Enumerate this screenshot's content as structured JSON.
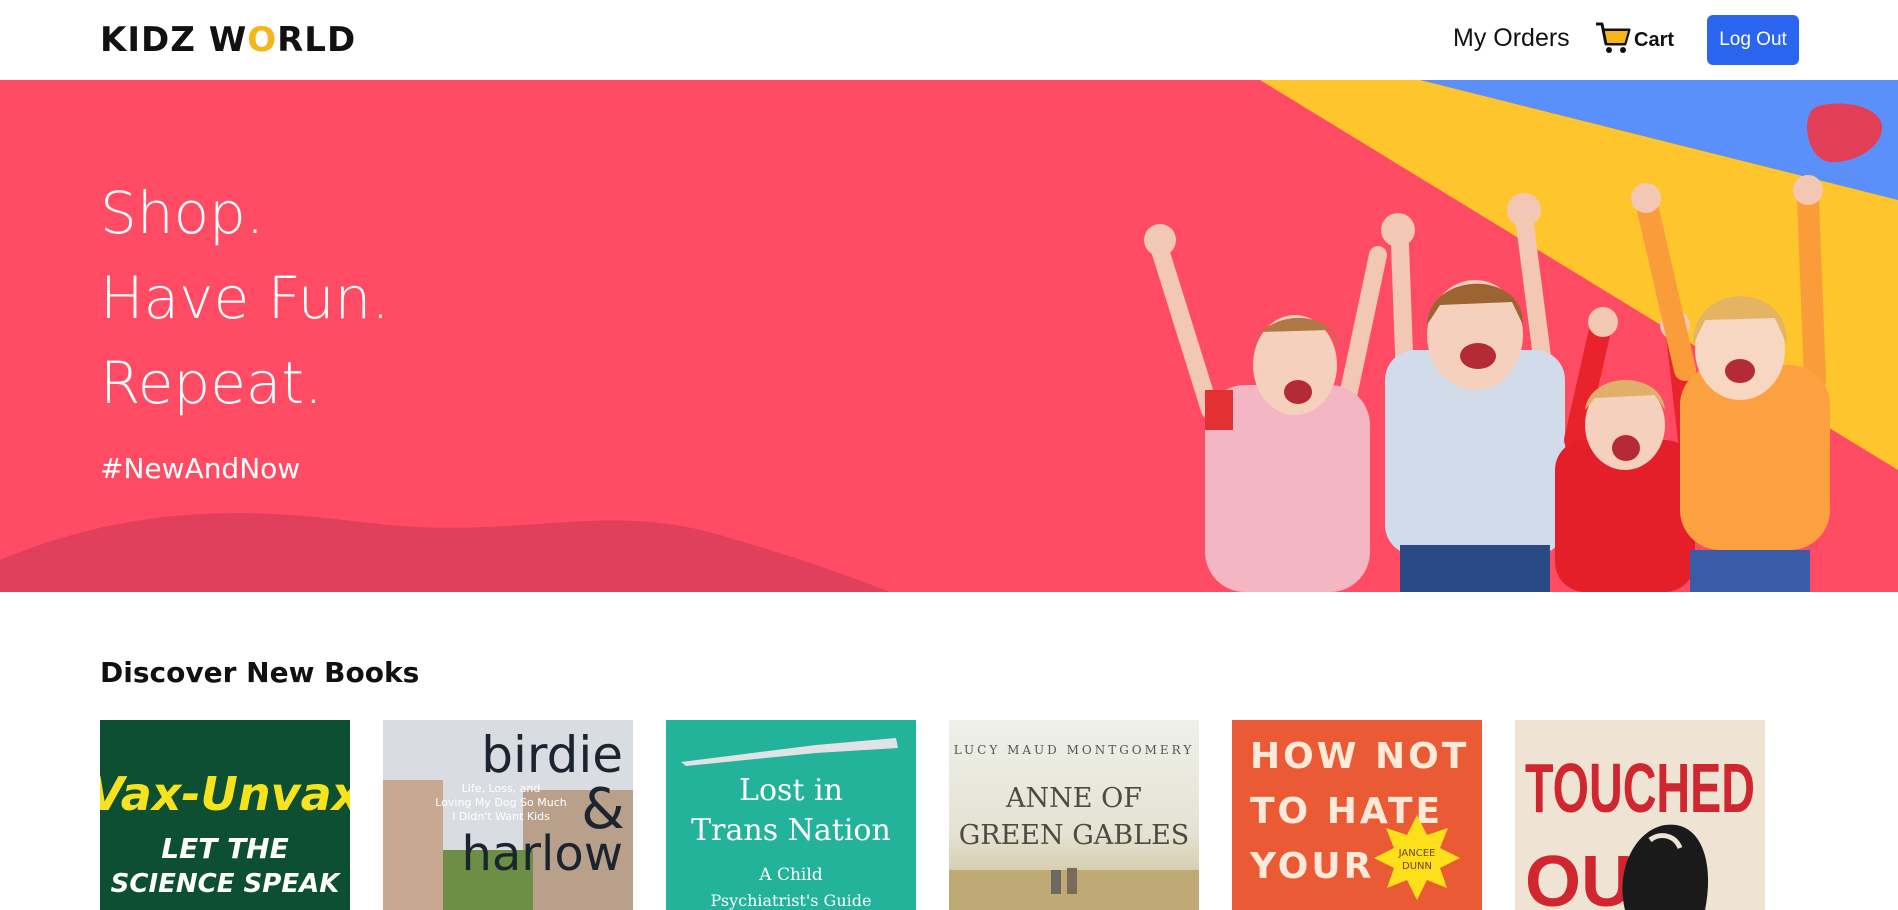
{
  "header": {
    "logo_prefix": "KIDZ W",
    "logo_o": "O",
    "logo_suffix": "RLD",
    "my_orders": "My Orders",
    "cart_label": "Cart",
    "cart_icon": "shopping-cart-icon",
    "logout_label": "Log Out"
  },
  "hero": {
    "line1": "Shop.",
    "line2": "Have Fun.",
    "line3": "Repeat.",
    "hashtag": "#NewAndNow",
    "image": "four-cheering-children"
  },
  "discover": {
    "title": "Discover New Books",
    "books": [
      {
        "cover_lines": [
          "Vax-Unvax",
          "LET THE",
          "SCIENCE SPEAK"
        ]
      },
      {
        "cover_lines": [
          "birdie",
          "&",
          "harlow",
          "Life, Loss, and",
          "Loving My Dog So Much",
          "I Didn't Want Kids"
        ]
      },
      {
        "cover_lines": [
          "Lost in",
          "Trans Nation",
          "A Child",
          "Psychiatrist's Guide"
        ]
      },
      {
        "cover_lines": [
          "LUCY MAUD MONTGOMERY",
          "ANNE OF",
          "GREEN GABLES"
        ]
      },
      {
        "cover_lines": [
          "HOW NOT",
          "TO HATE",
          "YOUR",
          "JANCEE",
          "DUNN"
        ]
      },
      {
        "cover_lines": [
          "TOUCHED",
          "OUT"
        ]
      }
    ]
  },
  "colors": {
    "hero_bg": "#ff4b63",
    "hero_wave": "#e0405c",
    "hero_yellow": "#ffc52d",
    "hero_blue": "#5b8ff9",
    "button_blue": "#2b64ef",
    "logo_accent": "#f5b51b"
  }
}
